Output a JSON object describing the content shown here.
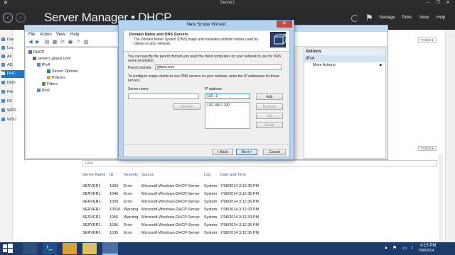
{
  "vm_window": {
    "title": "Server1"
  },
  "server_manager": {
    "breadcrumb": "Server Manager • DHCP",
    "menu": [
      "Manage",
      "Tools",
      "View",
      "Help"
    ],
    "sidebar": [
      "Das",
      "Loc",
      "All",
      "AD",
      "DHC",
      "DNS",
      "File",
      "IIS",
      "WDS",
      "WSU"
    ],
    "tasks_label": "TASKS"
  },
  "dhcp_console": {
    "menu": [
      "File",
      "Action",
      "View",
      "Help"
    ],
    "tree": {
      "root": "DHCP",
      "server": "server1.gitaus.com",
      "ipv4": "IPv4",
      "server_options": "Server Options",
      "policies": "Policies",
      "filters": "Filters",
      "ipv6": "IPv6"
    },
    "actions": {
      "header": "Actions",
      "selected": "IPv4",
      "more": "More Actions"
    }
  },
  "wizard": {
    "title": "New Scope Wizard",
    "heading": "Domain Name and DNS Servers",
    "description": "The Domain Name System (DNS) maps and translates domain names used by clients on your network.",
    "intro": "You can specify the parent domain you want the client computers on your network to use for DNS name resolution.",
    "parent_domain_label": "Parent domain:",
    "parent_domain_value": "gitaus.com",
    "configure_text": "To configure scope clients to use DNS servers on your network, enter the IP addresses for those servers.",
    "server_name_label": "Server name:",
    "server_name_value": "",
    "ip_label": "IP address:",
    "ip_value": "192 . 1",
    "buttons": {
      "resolve": "Resolve",
      "add": "Add",
      "remove": "Remove",
      "up": "Up",
      "down": "Down"
    },
    "dns_list": [
      "192.168.1.100"
    ],
    "footer": {
      "back": "< Back",
      "next": "Next >",
      "cancel": "Cancel"
    }
  },
  "events": {
    "filter_placeholder": "Filter",
    "columns": [
      "Server Name",
      "ID",
      "Severity",
      "Source",
      "Log",
      "Date and Time"
    ],
    "rows": [
      [
        "SERVER1",
        "1059",
        "Error",
        "Microsoft-Windows-DHCP-Server",
        "System",
        "7/08/2014 3:12:36 PM"
      ],
      [
        "SERVER1",
        "1046",
        "Error",
        "Microsoft-Windows-DHCP-Server",
        "System",
        "7/08/2014 3:12:36 PM"
      ],
      [
        "SERVER1",
        "1059",
        "Error",
        "Microsoft-Windows-DHCP-Server",
        "System",
        "7/08/2014 3:12:36 PM"
      ],
      [
        "SERVER1",
        "10020",
        "Warning",
        "Microsoft-Windows-DHCP-Server",
        "System",
        "7/08/2014 3:12:33 PM"
      ],
      [
        "SERVER1",
        "1056",
        "Warning",
        "Microsoft-Windows-DHCP-Server",
        "System",
        "7/08/2014 3:12:29 PM"
      ],
      [
        "SERVER1",
        "1036",
        "Error",
        "Microsoft-Windows-DHCP-Server",
        "System",
        "7/08/2014 3:12:36 PM"
      ],
      [
        "SERVER1",
        "1035",
        "Error",
        "Microsoft-Windows-DHCP-Server",
        "System",
        "7/08/2014 3:12:36 PM"
      ]
    ]
  },
  "taskbar": {
    "time": "4:15 PM",
    "date": "7/08/2014"
  },
  "colors": {
    "accent": "#1e78c8",
    "wizard_frame": "#b5d2ee",
    "taskbar": "#1c3a6a",
    "header": "#2b2b2b"
  }
}
